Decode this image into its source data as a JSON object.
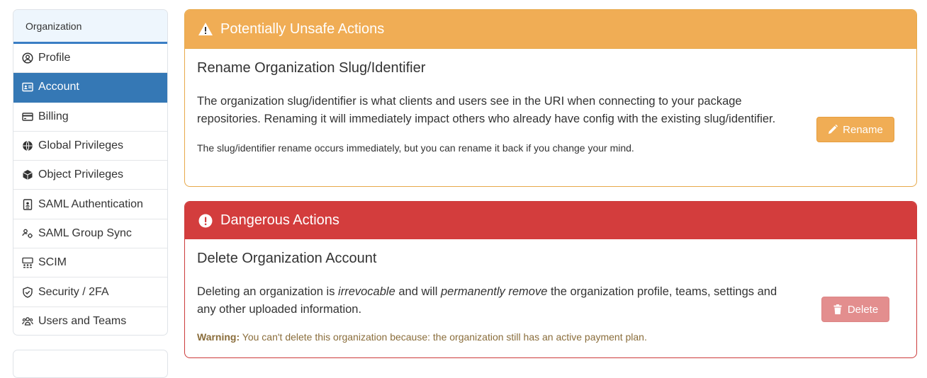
{
  "sidebar": {
    "header": "Organization",
    "items": [
      {
        "label": "Profile",
        "icon": "user-circle-icon",
        "active": false
      },
      {
        "label": "Account",
        "icon": "id-card-icon",
        "active": true
      },
      {
        "label": "Billing",
        "icon": "credit-card-icon",
        "active": false
      },
      {
        "label": "Global Privileges",
        "icon": "globe-icon",
        "active": false
      },
      {
        "label": "Object Privileges",
        "icon": "cube-icon",
        "active": false
      },
      {
        "label": "SAML Authentication",
        "icon": "id-badge-icon",
        "active": false
      },
      {
        "label": "SAML Group Sync",
        "icon": "users-cog-icon",
        "active": false
      },
      {
        "label": "SCIM",
        "icon": "network-users-icon",
        "active": false
      },
      {
        "label": "Security / 2FA",
        "icon": "shield-check-icon",
        "active": false
      },
      {
        "label": "Users and Teams",
        "icon": "users-icon",
        "active": false
      }
    ]
  },
  "unsafe": {
    "title": "Potentially Unsafe Actions",
    "icon": "warning-triangle-icon",
    "color": "#f0ad55",
    "rename": {
      "heading": "Rename Organization Slug/Identifier",
      "description": "The organization slug/identifier is what clients and users see in the URI when connecting to your package repositories. Renaming it will immediately impact others who already have config with the existing slug/identifier.",
      "note": "The slug/identifier rename occurs immediately, but you can rename it back if you change your mind.",
      "button_label": "Rename",
      "button_icon": "pencil-icon"
    }
  },
  "dangerous": {
    "title": "Dangerous Actions",
    "icon": "exclamation-circle-icon",
    "color": "#d33d3d",
    "delete": {
      "heading": "Delete Organization Account",
      "desc_part1": "Deleting an organization is ",
      "desc_em1": "irrevocable",
      "desc_part2": " and will ",
      "desc_em2": "permanently remove",
      "desc_part3": " the organization profile, teams, settings and any other uploaded information.",
      "warning_label": "Warning:",
      "warning_text": " You can't delete this organization because: the organization still has an active payment plan.",
      "button_label": "Delete",
      "button_icon": "trash-icon"
    }
  }
}
